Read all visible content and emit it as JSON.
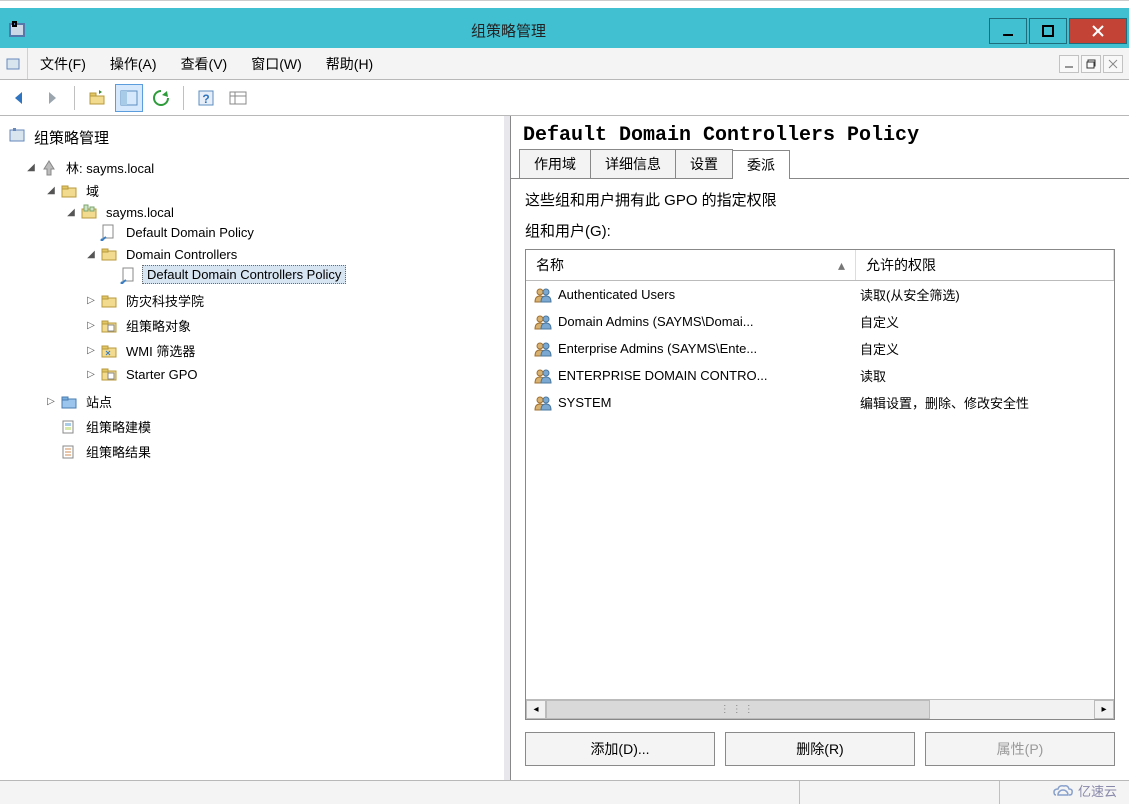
{
  "window": {
    "title": "组策略管理"
  },
  "menu": {
    "file": "文件(F)",
    "action": "操作(A)",
    "view": "查看(V)",
    "window": "窗口(W)",
    "help": "帮助(H)"
  },
  "toolbar": {
    "back": "后退",
    "forward": "前进",
    "up": "上一级",
    "properties": "属性",
    "refresh": "刷新",
    "help": "帮助",
    "export": "导出"
  },
  "tree": {
    "root": "组策略管理",
    "forest": "林: sayms.local",
    "domains": "域",
    "domain": "sayms.local",
    "default_policy": "Default Domain Policy",
    "domain_controllers": "Domain Controllers",
    "ddc_policy": "Default Domain Controllers Policy",
    "gpo_objects": "防灾科技学院",
    "gpo_objects2": "组策略对象",
    "wmi": "WMI 筛选器",
    "starter": "Starter GPO",
    "sites": "站点",
    "modeling": "组策略建模",
    "results": "组策略结果"
  },
  "detail": {
    "title": "Default Domain Controllers Policy",
    "tabs": {
      "scope": "作用域",
      "details": "详细信息",
      "settings": "设置",
      "delegation": "委派"
    },
    "info": "这些组和用户拥有此 GPO 的指定权限",
    "group_label": "组和用户(G):",
    "columns": {
      "name": "名称",
      "permission": "允许的权限"
    },
    "rows": [
      {
        "name": "Authenticated Users",
        "perm": "读取(从安全筛选)"
      },
      {
        "name": "Domain Admins (SAYMS\\Domai...",
        "perm": "自定义"
      },
      {
        "name": "Enterprise Admins (SAYMS\\Ente...",
        "perm": "自定义"
      },
      {
        "name": "ENTERPRISE DOMAIN CONTRO...",
        "perm": "读取"
      },
      {
        "name": "SYSTEM",
        "perm": "编辑设置，删除、修改安全性"
      }
    ],
    "buttons": {
      "add": "添加(D)...",
      "remove": "删除(R)",
      "properties": "属性(P)"
    }
  },
  "watermark": "亿速云"
}
